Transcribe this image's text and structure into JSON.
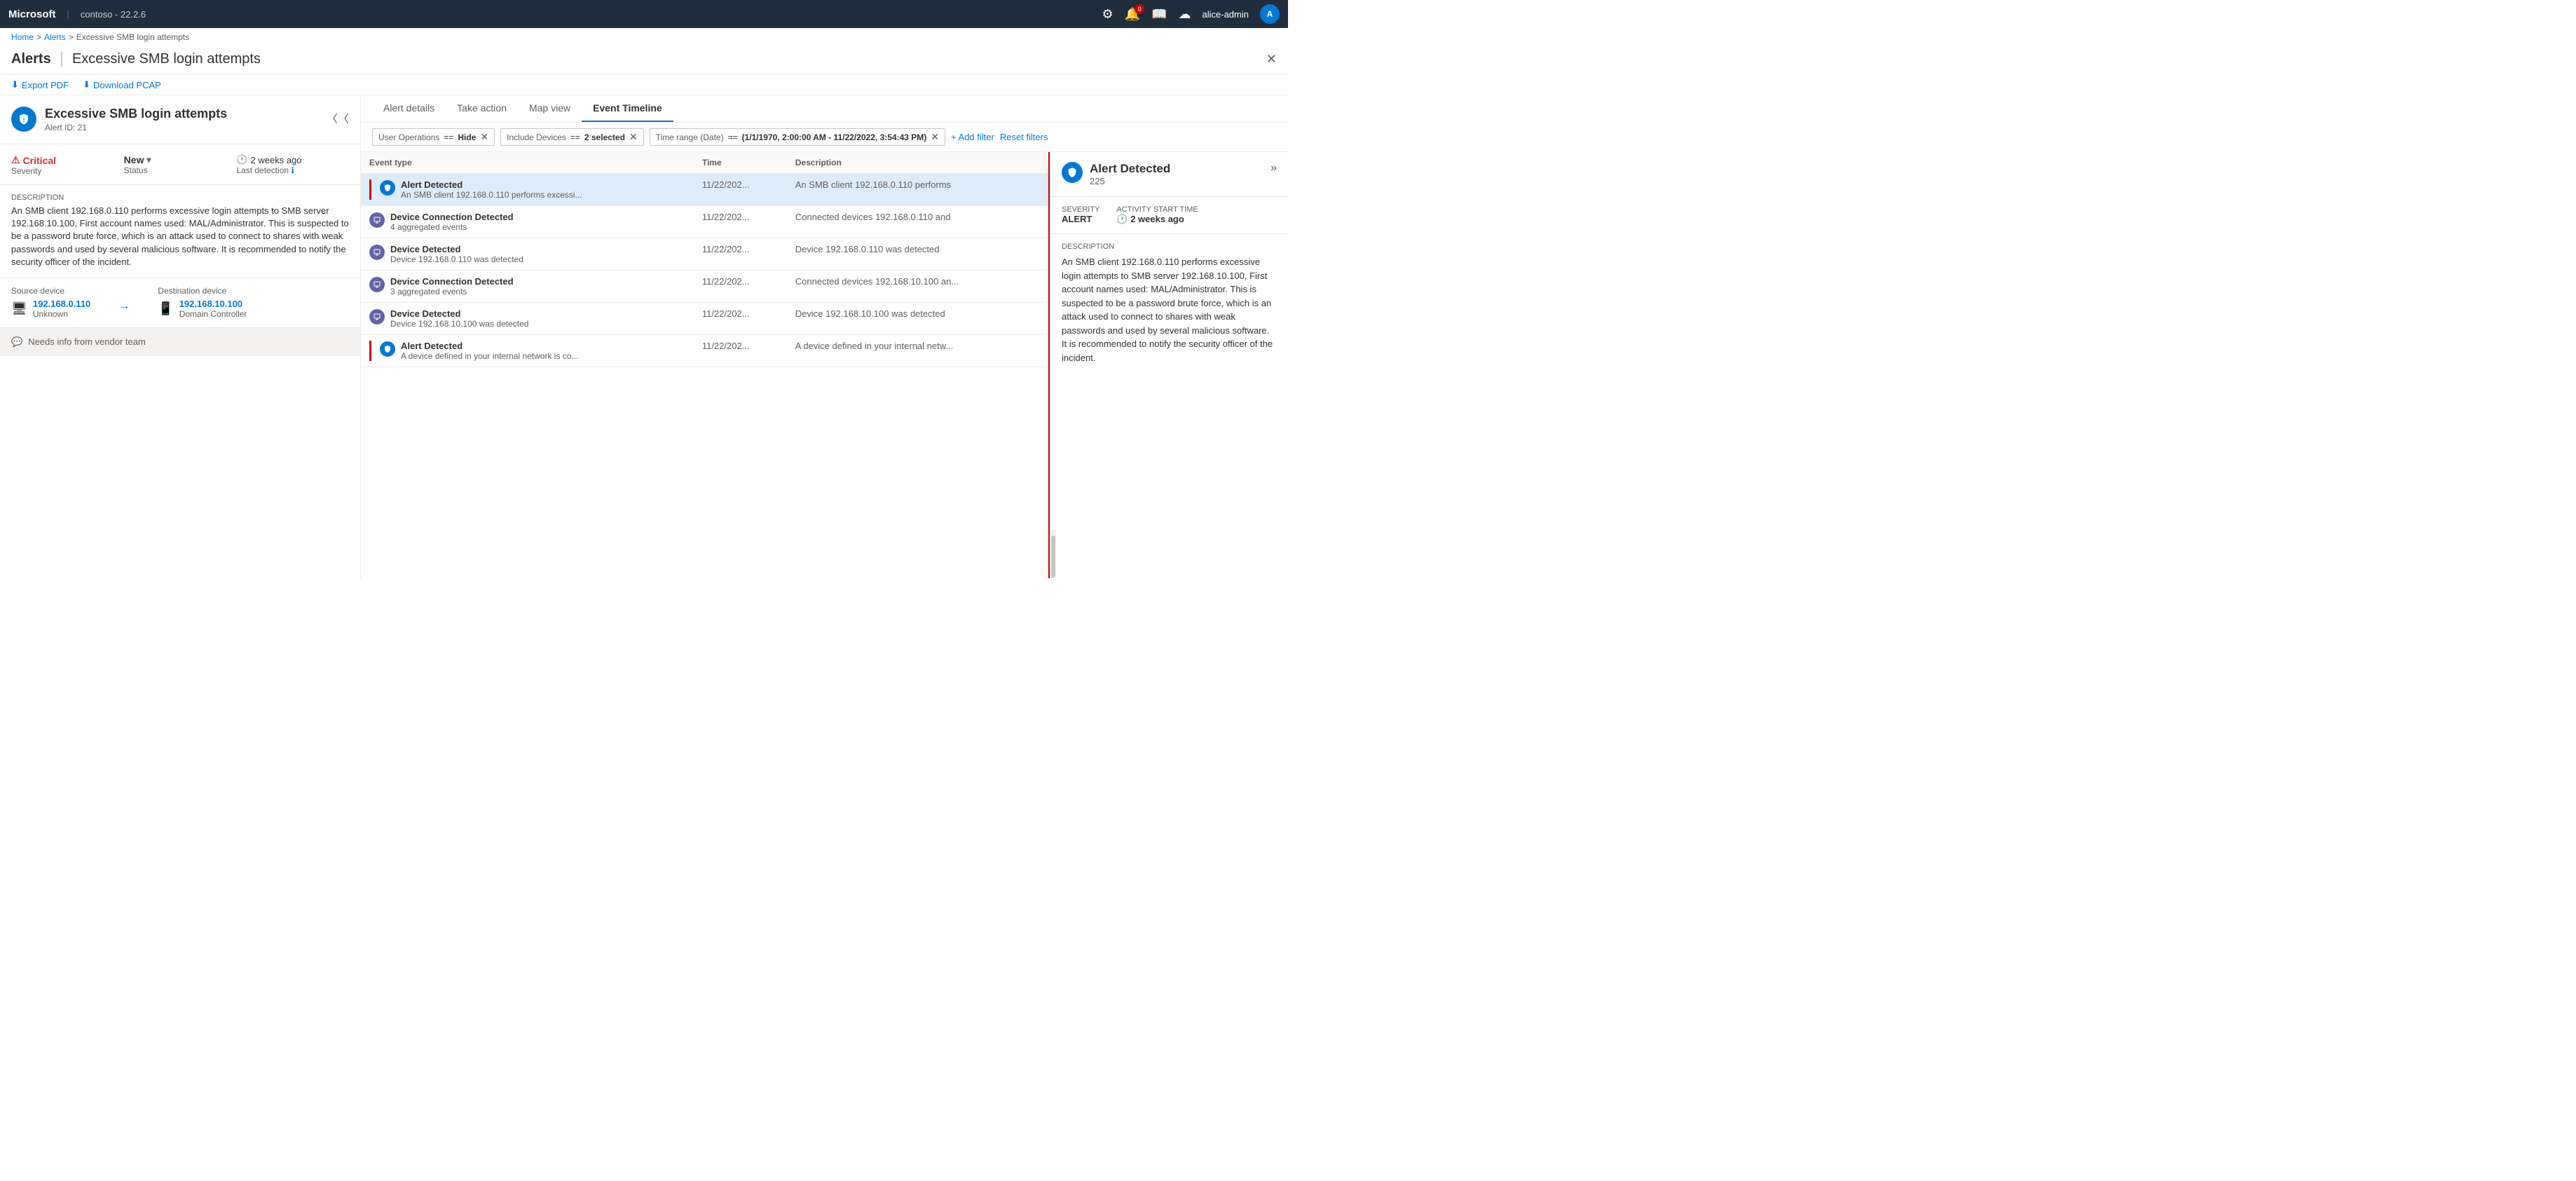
{
  "topnav": {
    "brand": "Microsoft",
    "separator": "|",
    "instance": "contoso - 22.2.6",
    "icons": {
      "settings": "⚙",
      "notifications": "🔔",
      "notifications_count": "0",
      "book": "📖",
      "cloud": "☁"
    },
    "username": "alice-admin",
    "avatar_initials": "A"
  },
  "breadcrumb": {
    "home": "Home",
    "alerts": "Alerts",
    "current": "Excessive SMB login attempts"
  },
  "page": {
    "title": "Alerts",
    "subtitle": "Excessive SMB login attempts",
    "close_label": "✕"
  },
  "actions": {
    "export_pdf": "Export PDF",
    "download_pcap": "Download PCAP"
  },
  "alert": {
    "icon": "!",
    "name": "Excessive SMB login attempts",
    "id_label": "Alert ID: 21",
    "severity_label": "Severity",
    "severity_value": "Critical",
    "status_label": "Status",
    "status_value": "New",
    "last_detection_label": "Last detection",
    "last_detection_value": "2 weeks ago",
    "description_label": "Description",
    "description": "An SMB client 192.168.0.110 performs excessive login attempts to SMB server 192.168.10.100, First account names used: MAL/Administrator. This is suspected to be a password brute force, which is an attack used to connect to shares with weak passwords and used by several malicious software. It is recommended to notify the security officer of the incident.",
    "source_label": "Source device",
    "source_ip": "192.168.0.110",
    "source_type": "Unknown",
    "dest_label": "Destination device",
    "dest_ip": "192.168.10.100",
    "dest_type": "Domain Controller",
    "comment": "Needs info from vendor team"
  },
  "tabs": [
    {
      "id": "alert-details",
      "label": "Alert details",
      "active": false
    },
    {
      "id": "take-action",
      "label": "Take action",
      "active": false
    },
    {
      "id": "map-view",
      "label": "Map view",
      "active": false
    },
    {
      "id": "event-timeline",
      "label": "Event Timeline",
      "active": true
    }
  ],
  "filters": [
    {
      "key": "User Operations",
      "op": "==",
      "value": "Hide",
      "removable": true
    },
    {
      "key": "Include Devices",
      "op": "==",
      "value": "2 selected",
      "removable": true
    },
    {
      "key": "Time range (Date)",
      "op": "==",
      "value": "(1/1/1970, 2:00:00 AM - 11/22/2022, 3:54:43 PM)",
      "removable": true
    }
  ],
  "filter_actions": {
    "add": "+ Add filter",
    "reset": "Reset filters"
  },
  "event_table": {
    "columns": [
      "Event type",
      "Time",
      "Description"
    ],
    "rows": [
      {
        "type": "Alert Detected",
        "sub": "An SMB client 192.168.0.110 performs excessi...",
        "icon_type": "alert",
        "time": "11/22/202...",
        "description": "An SMB client 192.168.0.110 performs",
        "selected": true,
        "red_bar": true
      },
      {
        "type": "Device Connection Detected",
        "sub": "4 aggregated events",
        "icon_type": "device",
        "time": "11/22/202...",
        "description": "Connected devices 192.168.0.110 and",
        "selected": false,
        "red_bar": false
      },
      {
        "type": "Device Detected",
        "sub": "Device 192.168.0.110 was detected",
        "icon_type": "device",
        "time": "11/22/202...",
        "description": "Device 192.168.0.110 was detected",
        "selected": false,
        "red_bar": false
      },
      {
        "type": "Device Connection Detected",
        "sub": "3 aggregated events",
        "icon_type": "device",
        "time": "11/22/202...",
        "description": "Connected devices 192.168.10.100 an...",
        "selected": false,
        "red_bar": false
      },
      {
        "type": "Device Detected",
        "sub": "Device 192.168.10.100 was detected",
        "icon_type": "device",
        "time": "11/22/202...",
        "description": "Device 192.168.10.100 was detected",
        "selected": false,
        "red_bar": false
      },
      {
        "type": "Alert Detected",
        "sub": "A device defined in your internal network is co...",
        "icon_type": "alert",
        "time": "11/22/202...",
        "description": "A device defined in your internal netw...",
        "selected": false,
        "red_bar": true
      }
    ]
  },
  "detail_panel": {
    "icon": "!",
    "title": "Alert Detected",
    "count": "225",
    "expand_icon": "»",
    "severity_label": "ALERT",
    "severity_sublabel": "Severity",
    "time_label": "2 weeks ago",
    "time_sublabel": "Activity start time",
    "description_label": "Description",
    "description": "An SMB client 192.168.0.110 performs excessive login attempts to SMB server 192.168.10.100, First account names used: MAL/Administrator. This is suspected to be a password brute force, which is an attack used to connect to shares with weak passwords and used by several malicious software. It is recommended to notify the security officer of the incident."
  }
}
